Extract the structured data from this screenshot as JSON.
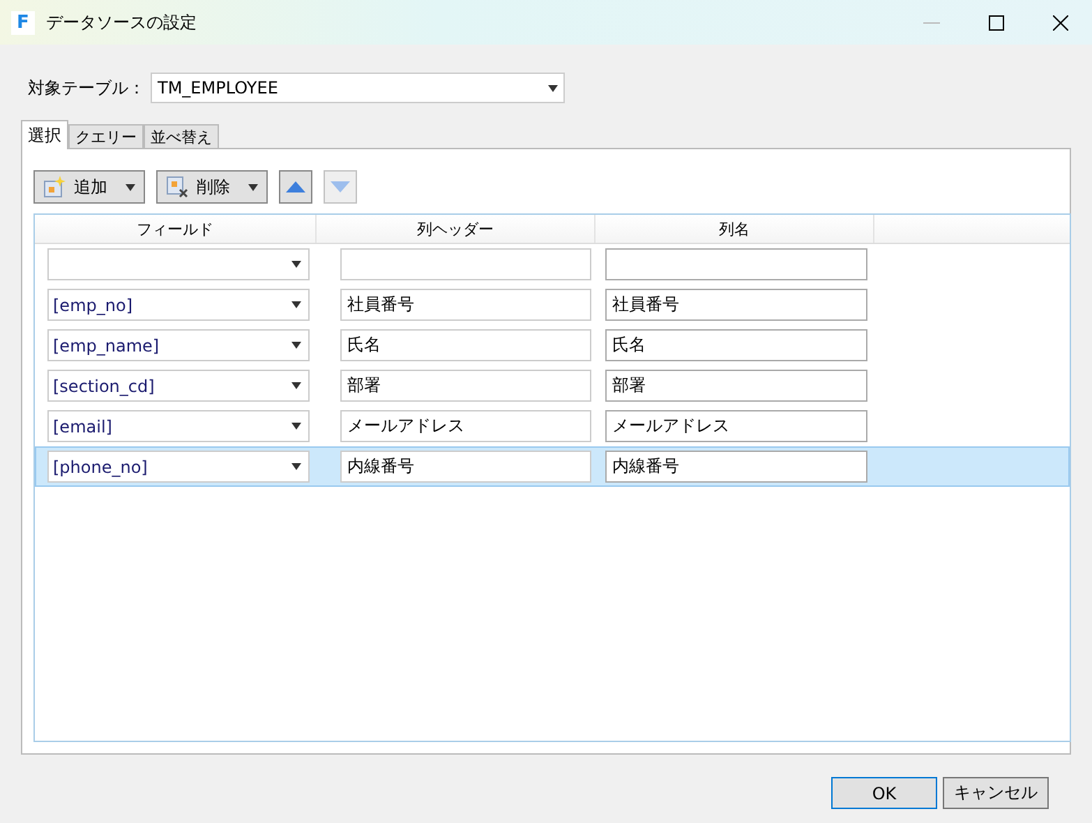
{
  "window": {
    "title": "データソースの設定",
    "icon_letter": "F"
  },
  "target_table": {
    "label": "対象テーブル：",
    "value": "TM_EMPLOYEE"
  },
  "tabs": [
    {
      "label": "選択",
      "selected": true
    },
    {
      "label": "クエリー",
      "selected": false
    },
    {
      "label": "並べ替え",
      "selected": false
    }
  ],
  "toolbar": [
    {
      "kind": "add",
      "label": "追加",
      "disabled": false
    },
    {
      "kind": "delete",
      "label": "削除",
      "disabled": false
    },
    {
      "kind": "up",
      "disabled": false
    },
    {
      "kind": "down",
      "disabled": true
    }
  ],
  "table": {
    "columns": [
      "フィールド",
      "列ヘッダー",
      "列名"
    ],
    "rows": [
      {
        "field": "",
        "header": "",
        "name": "",
        "selected": false
      },
      {
        "field": "[emp_no]",
        "header": "社員番号",
        "name": "社員番号",
        "selected": false
      },
      {
        "field": "[emp_name]",
        "header": "氏名",
        "name": "氏名",
        "selected": false
      },
      {
        "field": "[section_cd]",
        "header": "部署",
        "name": "部署",
        "selected": false
      },
      {
        "field": "[email]",
        "header": "メールアドレス",
        "name": "メールアドレス",
        "selected": false
      },
      {
        "field": "[phone_no]",
        "header": "内線番号",
        "name": "内線番号",
        "selected": true
      }
    ]
  },
  "buttons": [
    {
      "label": "OK",
      "default": true
    },
    {
      "label": "キャンセル",
      "default": false
    }
  ]
}
